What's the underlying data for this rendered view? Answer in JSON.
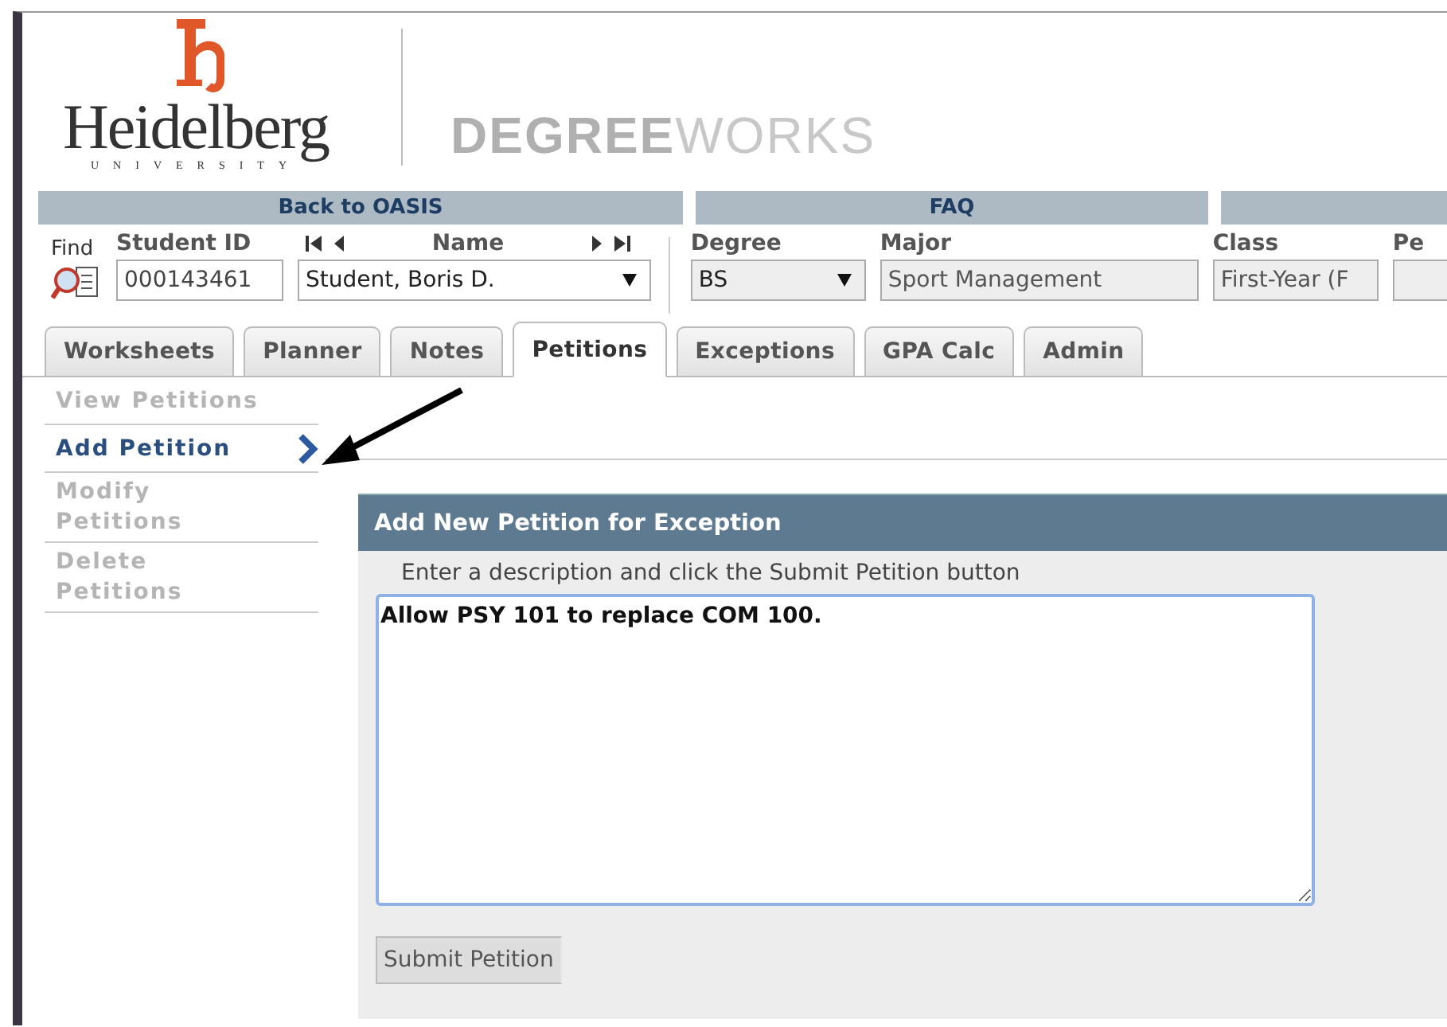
{
  "logo": {
    "name": "Heidelberg",
    "subtitle": "UNIVERSITY"
  },
  "product": {
    "title": "**DEGREE**WORKS"
  },
  "nav_bar": [
    "Back to OASIS",
    "FAQ"
  ],
  "student_bar": {
    "find_label": "Find",
    "student_id": {
      "label": "Student ID",
      "value": "000143461"
    },
    "name": {
      "label": "Name",
      "value": "Student, Boris D."
    },
    "degree": {
      "label": "Degree",
      "value": "BS"
    },
    "major": {
      "label": "Major",
      "value": "Sport Management"
    },
    "class": {
      "label": "Class",
      "value": "First-Year (F"
    },
    "column_5": {
      "label": "Pe"
    }
  },
  "tabs": [
    {
      "label": "Worksheets",
      "selected": false
    },
    {
      "label": "Planner",
      "selected": false
    },
    {
      "label": "Notes",
      "selected": false
    },
    {
      "label": "Petitions",
      "selected": true
    },
    {
      "label": "Exceptions",
      "selected": false
    },
    {
      "label": "GPA Calc",
      "selected": false
    },
    {
      "label": "Admin",
      "selected": false
    }
  ],
  "side_menu": [
    {
      "label": "View Petitions",
      "selected": false
    },
    {
      "label": "Add Petition",
      "selected": true
    },
    {
      "label": "Modify Petitions",
      "selected": false
    },
    {
      "label": "Delete Petitions",
      "selected": false
    }
  ],
  "panel": {
    "title": "Add New Petition for Exception",
    "instruction": "Enter a description and click the Submit Petition button",
    "description": "Allow PSY 101 to replace COM 100.",
    "submit": "Submit Petition"
  }
}
